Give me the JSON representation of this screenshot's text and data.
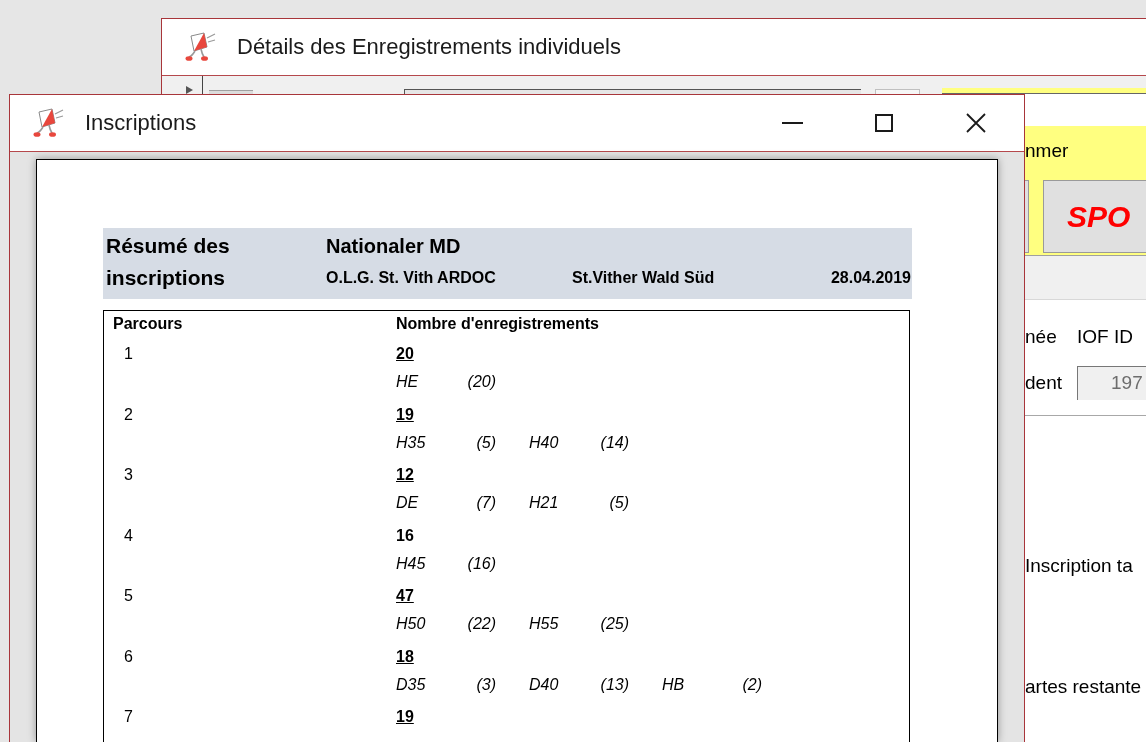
{
  "form_window": {
    "title": "Détails des Enregistrements individuels",
    "header": {
      "label": "nmer",
      "button": "SPO"
    },
    "labels": [
      "née",
      "IOF ID"
    ],
    "field": {
      "label": "dent",
      "value": "197"
    },
    "notes": [
      "Inscription ta",
      "artes restante"
    ]
  },
  "report_window": {
    "title": "Inscriptions",
    "report": {
      "title": "Résumé des inscriptions",
      "event": "Nationaler MD",
      "organizer": "O.L.G. St. Vith ARDOC",
      "map": "St.Vither Wald Süd",
      "date": "28.04.2019",
      "columns": [
        "Parcours",
        "Nombre d'enregistrements"
      ],
      "courses": [
        {
          "course": "1",
          "total": "20",
          "underlined": true,
          "classes": [
            {
              "name": "HE",
              "count": "(20)"
            }
          ]
        },
        {
          "course": "2",
          "total": "19",
          "underlined": true,
          "classes": [
            {
              "name": "H35",
              "count": "(5)"
            },
            {
              "name": "H40",
              "count": "(14)"
            }
          ]
        },
        {
          "course": "3",
          "total": "12",
          "underlined": true,
          "classes": [
            {
              "name": "DE",
              "count": "(7)"
            },
            {
              "name": "H21",
              "count": "(5)"
            }
          ]
        },
        {
          "course": "4",
          "total": "16",
          "underlined": false,
          "classes": [
            {
              "name": "H45",
              "count": "(16)"
            }
          ]
        },
        {
          "course": "5",
          "total": "47",
          "underlined": true,
          "classes": [
            {
              "name": "H50",
              "count": "(22)"
            },
            {
              "name": "H55",
              "count": "(25)"
            }
          ]
        },
        {
          "course": "6",
          "total": "18",
          "underlined": true,
          "classes": [
            {
              "name": "D35",
              "count": "(3)"
            },
            {
              "name": "D40",
              "count": "(13)"
            },
            {
              "name": "HB",
              "count": "(2)"
            }
          ]
        },
        {
          "course": "7",
          "total": "19",
          "underlined": true
        }
      ]
    }
  }
}
